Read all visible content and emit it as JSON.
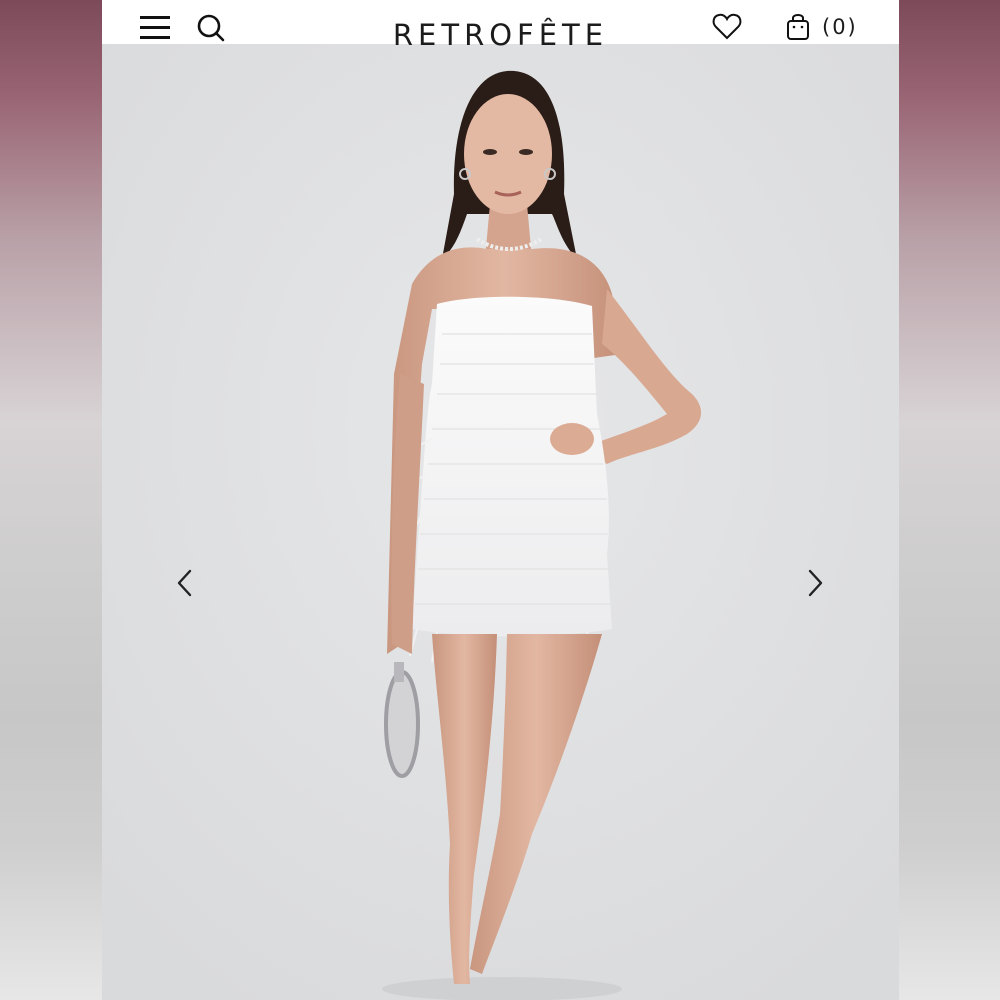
{
  "header": {
    "brand": "RETROFÊTE",
    "cart_count": "(0)",
    "icons": {
      "menu": "hamburger-menu-icon",
      "search": "search-icon",
      "wishlist": "heart-icon",
      "cart": "shopping-bag-icon"
    }
  },
  "gallery": {
    "prev_icon": "chevron-left-icon",
    "next_icon": "chevron-right-icon"
  },
  "colors": {
    "header_bg": "#ffffff",
    "text": "#1c1c1c",
    "photo_bg": "#e0e1e3",
    "dress": "#f6f6f6"
  }
}
